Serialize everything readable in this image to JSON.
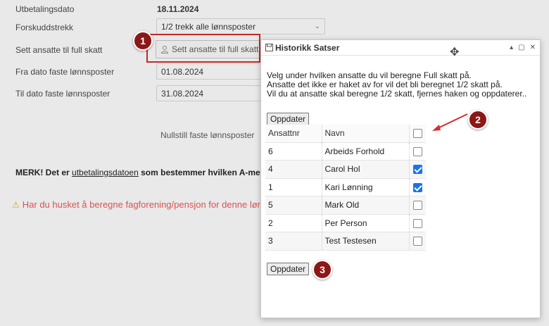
{
  "form": {
    "payment_date_label": "Utbetalingsdato",
    "payment_date_value": "18.11.2024",
    "advance_label": "Forskuddstrekk",
    "advance_value": "1/2 trekk alle lønnsposter",
    "full_tax_label": "Sett ansatte til full skatt",
    "full_tax_button": "Sett ansatte til full skatt",
    "from_label": "Fra dato faste lønnsposter",
    "from_value": "01.08.2024",
    "to_label": "Til dato faste lønnsposter",
    "to_value": "31.08.2024",
    "reset_label": "Nullstill faste lønnsposter",
    "note_prefix": "MERK! Det er ",
    "note_link": "utbetalingsdatoen",
    "note_suffix": " som bestemmer hvilken A-meldingsm",
    "warning": "Har du husket å beregne fagforening/pensjon for denne lønn"
  },
  "dialog": {
    "title": "Historikk Satser",
    "intro_line1": "Velg under hvilken ansatte du vil beregne Full skatt på.",
    "intro_line2": "Ansatte det ikke er haket av for vil det bli beregnet 1/2 skatt på.",
    "intro_line3": "Vil du at ansatte skal beregne 1/2 skatt, fjernes haken og oppdaterer..",
    "update_top": "Oppdater",
    "update_bottom": "Oppdater",
    "col_num": "Ansattnr",
    "col_name": "Navn",
    "rows": [
      {
        "num": "6",
        "name": "Arbeids Forhold",
        "checked": false
      },
      {
        "num": "4",
        "name": "Carol Hol",
        "checked": true
      },
      {
        "num": "1",
        "name": "Kari Lønning",
        "checked": true
      },
      {
        "num": "5",
        "name": "Mark Old",
        "checked": false
      },
      {
        "num": "2",
        "name": "Per Person",
        "checked": false
      },
      {
        "num": "3",
        "name": "Test Testesen",
        "checked": false
      }
    ]
  },
  "badges": {
    "one": "1",
    "two": "2",
    "three": "3"
  },
  "colors": {
    "badge": "#8b1717",
    "frame": "#c22a2a",
    "check": "#1a73e8",
    "warning": "#d9534f"
  },
  "icons": [
    "user-icon",
    "chevron-down-icon",
    "save-icon",
    "minimize-icon",
    "maximize-icon",
    "close-icon",
    "move-icon",
    "warning-icon",
    "arrow-icon"
  ]
}
